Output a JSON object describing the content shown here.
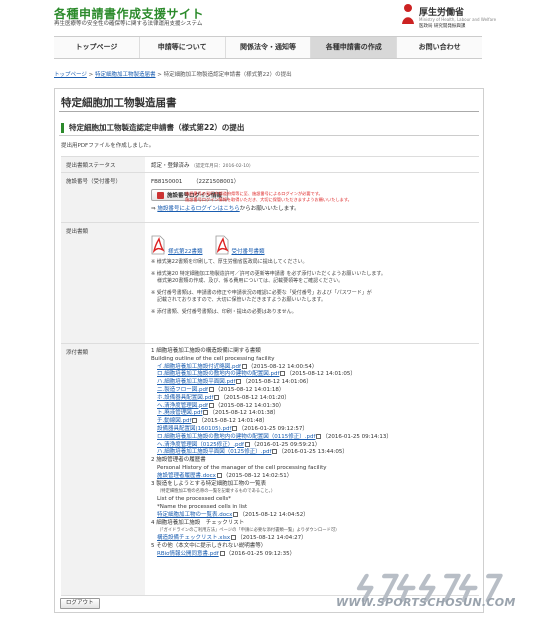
{
  "header": {
    "site_title": "各種申請書作成支援サイト",
    "site_subtitle": "再生医療等の安全性の確保等に関する法律運用支援システム",
    "logo_text": "厚生労働省",
    "logo_sub": "Ministry of Health, Labour and Welfare",
    "logo_sub2": "医政局 研究開発振興課"
  },
  "nav": {
    "items": [
      {
        "label": "トップページ"
      },
      {
        "label": "申請等について"
      },
      {
        "label": "関係法令・通知等"
      },
      {
        "label": "各種申請書の作成"
      },
      {
        "label": "お問い合わせ"
      }
    ]
  },
  "breadcrumb": {
    "top": "トップページ",
    "sep": " > ",
    "mid": "特定細胞加工物製造届書",
    "current": "特定細胞加工物製造認定申請書（様式第22）の提出"
  },
  "panel": {
    "title": "特定細胞加工物製造届書",
    "section_title": "特定細胞加工物製造認定申請書（様式第22）の提出",
    "intro": "提出用PDFファイルを作成しました。"
  },
  "table": {
    "status": {
      "label": "提出書類ステータス",
      "value": "認定・登録済み",
      "date": "（認定年月日：2016-02-10）"
    },
    "facility": {
      "label": "施設番号（受付番号）",
      "number": "FB8150001",
      "receipt": "（22Z1508001）",
      "login_button": "施設番号ログイン情報",
      "red_note_1": "施設番号の発行や都道府県等に至、施設番号によるログインが必要です。",
      "red_note_2": "施設番号ログイン情報を取得いただき、大切に保管いただきますようお願いいたします。",
      "login_link": "施設番号によるログインはこちら",
      "login_link_suffix": "からお願いいたします。"
    },
    "submission": {
      "label": "提出書類",
      "pdf1": "様式第22書類",
      "pdf2": "受付番号書類",
      "note1": "※ 様式第22書類を印刷して、厚生労働省医政局に提出してください。",
      "note2a": "※ 様式第20 特定細胞加工物製造許可／許可の更新等申請書 を必ず添付いただくようお願いいたします。",
      "note2b": "様式第20書類の作成、及び、係る費用については、記載要領等をご確認ください。",
      "note3a": "※ 受付番号書類は、申請書の修正や申請状況の確認に必要な「受付番号」および「パスワード」が",
      "note3b": "記載されておりますので、大切に保管いただきますようお願いいたします。",
      "note4": "※ 添付書類、受付番号書類は、印刷・提出の必要はありません。"
    },
    "attachments": {
      "label": "添付書類",
      "g1_title": "1 細胞培養加工施設の構造設備に関する書類",
      "g1_en": "Building outline of the cell processing facility",
      "g1_items": [
        {
          "name": "イ.細胞培養加工施設付近略図.pdf",
          "date": "（2015-08-12 14:00:54）"
        },
        {
          "name": "ロ.細胞培養加工施設の敷地内の建物の配置図.pdf",
          "date": "（2015-08-12 14:01:05）"
        },
        {
          "name": "ハ.細胞培養加工施設平面図.pdf",
          "date": "（2015-08-12 14:01:06）"
        },
        {
          "name": "二.製造フロー図.pdf",
          "date": "（2015-08-12 14:01:18）"
        },
        {
          "name": "ホ.設備器具配置図.pdf",
          "date": "（2015-08-12 14:01:20）"
        },
        {
          "name": "へ.清浄度管理図.pdf",
          "date": "（2015-08-12 14:01:30）"
        },
        {
          "name": "ト.廃液管理図.pdf",
          "date": "（2015-08-12 14:01:38）"
        },
        {
          "name": "チ.動線図.pdf",
          "date": "（2015-08-12 14:01:48）"
        },
        {
          "name": "設備器具配置図(160105).pdf",
          "date": "（2016-01-25 09:12:57）"
        },
        {
          "name": "ロ.細胞培養加工施設の敷地内の建物の配置図（0115修正）.pdf",
          "date": "（2016-01-25 09:14:13）"
        },
        {
          "name": "へ.清浄度管理図（0125修正）.pdf",
          "date": "（2016-01-25 09:59:21）"
        },
        {
          "name": "ハ.細胞培養加工施設平面図（0125修正）.pdf",
          "date": "（2016-01-25 13:44:05）"
        }
      ],
      "g2_title": "2 施設管理者の履歴書",
      "g2_en": "Personal History of the manager of the cell processing facility",
      "g2_items": [
        {
          "name": "施設管理者履歴書.docx",
          "date": "（2015-08-12 14:02:51）"
        }
      ],
      "g3_title": "3 製造をしようとする特定細胞加工物の一覧表",
      "g3_note": "（特定細胞加工物の名称の一覧を記載するものであること。）",
      "g3_en1": "List of the processed cells*",
      "g3_en2": "*Name the processed cells in list",
      "g3_items": [
        {
          "name": "特定細胞加工物の一覧表.docx",
          "date": "（2015-08-12 14:04:52）"
        }
      ],
      "g4_title": "4 細胞培養加工施設　チェックリスト",
      "g4_note": "（「ガイドラインのご利用方法」ページの「申請に必要な添付書類一覧」よりダウンロード可）",
      "g4_items": [
        {
          "name": "構造設備チェックリスト.xlsx",
          "date": "（2015-08-12 14:04:27）"
        }
      ],
      "g5_title": "5 その他（本文中に提示しきれない説明書等）",
      "g5_items": [
        {
          "name": "RBio情報公開同意書.pdf",
          "date": "（2016-01-25 09:12:35）"
        }
      ]
    }
  },
  "logout_label": "ログアウト",
  "watermark": {
    "url": "WWW.SPORTSCHOSUN.COM"
  },
  "colors": {
    "accent_green": "#2b8a2b",
    "link_blue": "#1a5db0",
    "alert_red": "#d22222",
    "logo_red": "#cc2222"
  }
}
